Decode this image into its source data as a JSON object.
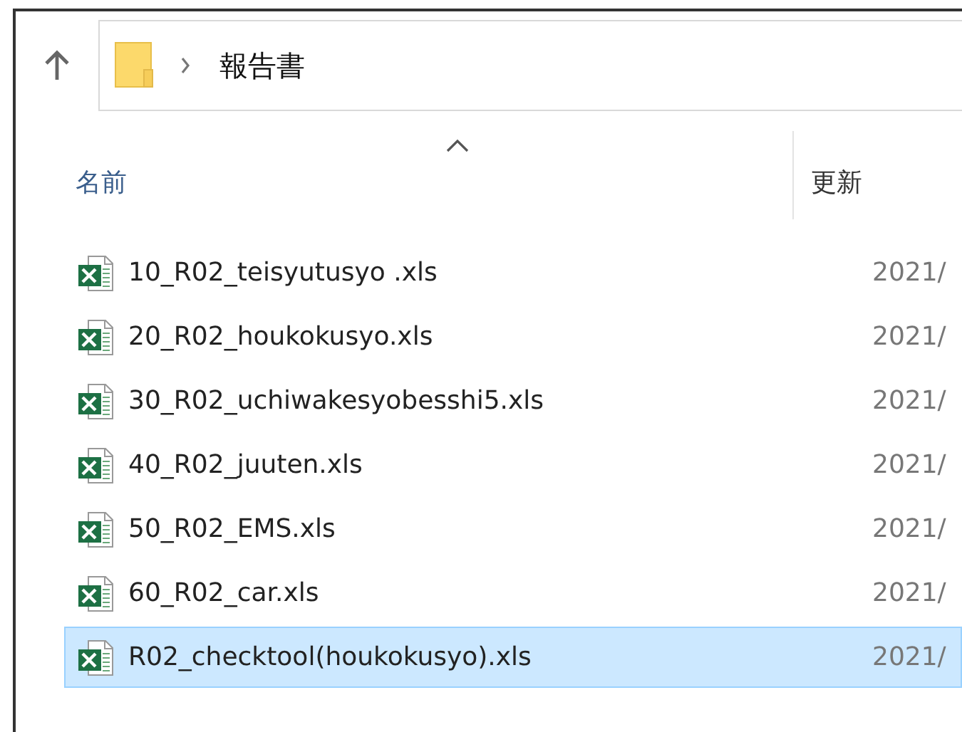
{
  "address_bar": {
    "path": "報告書"
  },
  "columns": [
    {
      "label": "名前",
      "sorted": true
    },
    {
      "label": "更新"
    }
  ],
  "files": [
    {
      "name": "10_R02_teisyutusyo .xls",
      "modified": "2021/",
      "selected": false
    },
    {
      "name": "20_R02_houkokusyo.xls",
      "modified": "2021/",
      "selected": false
    },
    {
      "name": "30_R02_uchiwakesyobesshi5.xls",
      "modified": "2021/",
      "selected": false
    },
    {
      "name": "40_R02_juuten.xls",
      "modified": "2021/",
      "selected": false
    },
    {
      "name": "50_R02_EMS.xls",
      "modified": "2021/",
      "selected": false
    },
    {
      "name": "60_R02_car.xls",
      "modified": "2021/",
      "selected": false
    },
    {
      "name": "R02_checktool(houkokusyo).xls",
      "modified": "2021/",
      "selected": true
    }
  ]
}
